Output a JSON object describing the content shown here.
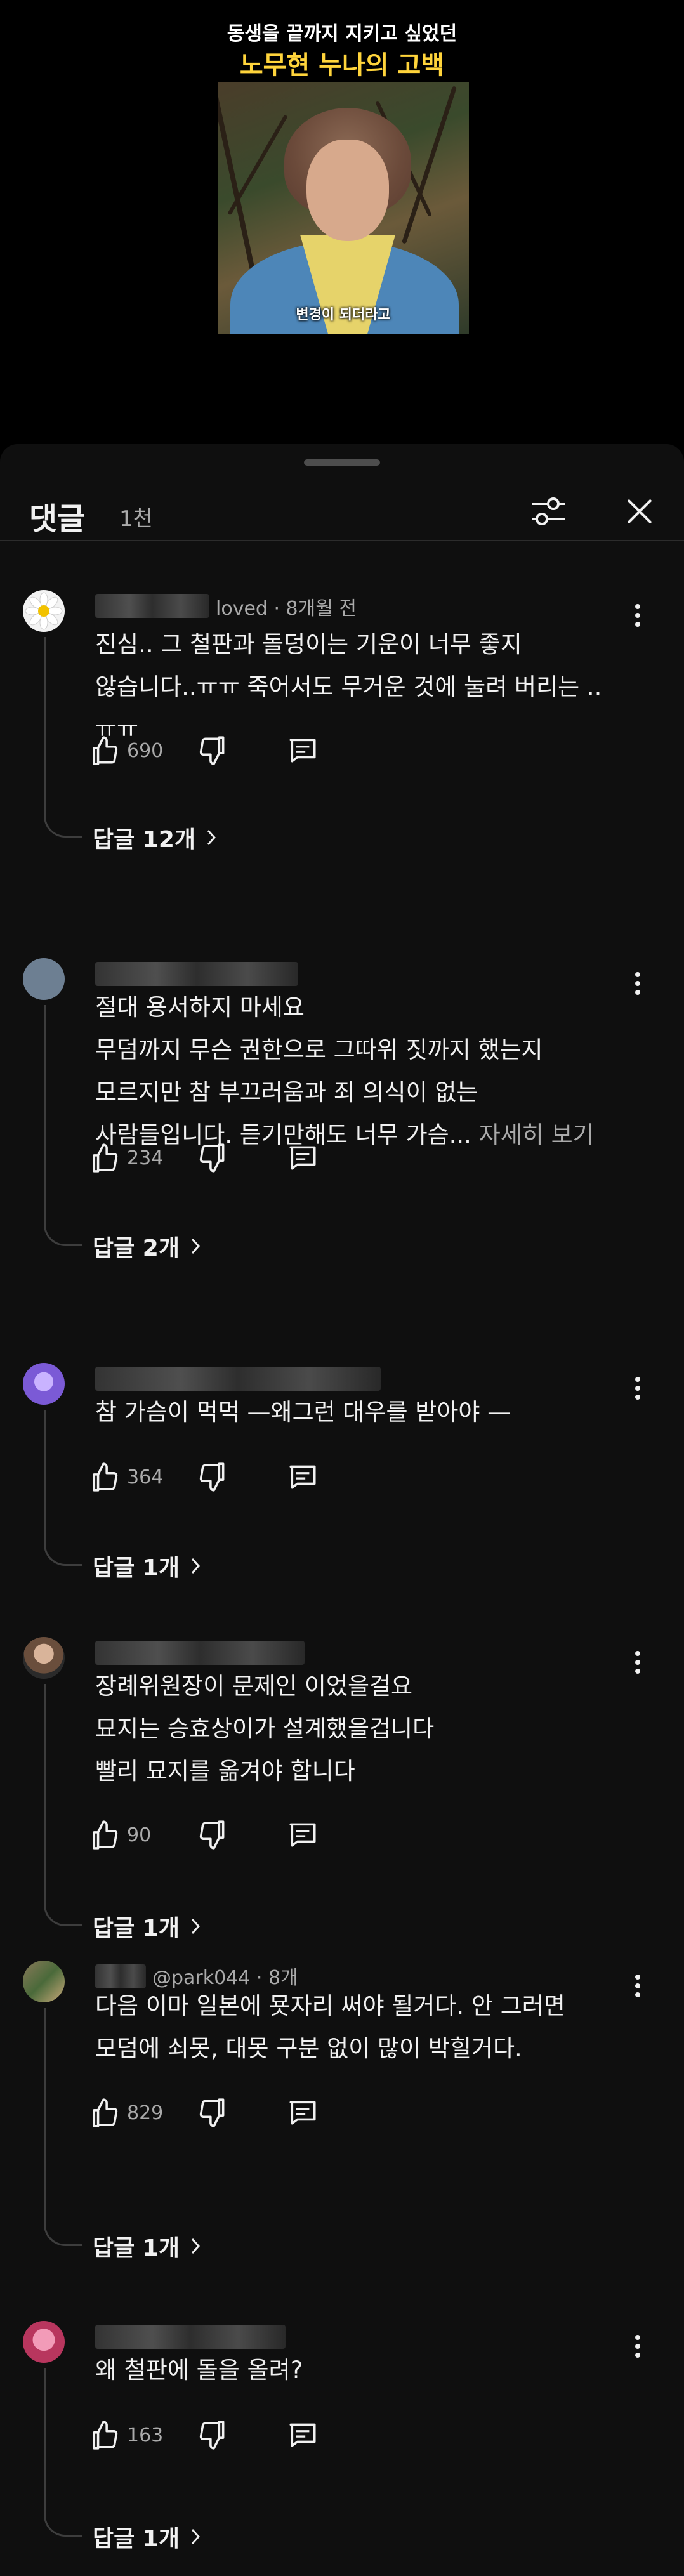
{
  "video": {
    "caption_line1": "동생을 끝까지 지키고 싶었던",
    "caption_line2": "노무현 누나의 고백",
    "subtitle": "변경이 되더라고"
  },
  "sheet": {
    "title": "댓글",
    "count": "1천"
  },
  "comments": [
    {
      "meta": "loved · 8개월 전",
      "lines": [
        "진심.. 그 철판과 돌덩이는 기운이 너무 좋지",
        "않습니다..ㅠㅠ 죽어서도 무거운 것에 눌려 버리는 ..",
        "ㅠㅠ"
      ],
      "read_more": "",
      "likes": "690",
      "replies": "답글 12개"
    },
    {
      "meta": "",
      "lines": [
        "절대 용서하지 마세요",
        "무덤까지 무슨 권한으로 그따위 짓까지 했는지",
        "모르지만 참 부끄러움과 죄 의식이 없는",
        "사람들입니다. 듣기만해도 너무 가슴... "
      ],
      "read_more": "자세히 보기",
      "likes": "234",
      "replies": "답글 2개"
    },
    {
      "meta": "",
      "lines": [
        "참 가슴이 먹먹 —왜그런 대우를 받아야 —"
      ],
      "read_more": "",
      "likes": "364",
      "replies": "답글 1개"
    },
    {
      "meta": "",
      "lines": [
        "장례위원장이 문제인 이었을걸요",
        "묘지는 승효상이가 설계했을겁니다",
        "빨리 묘지를 옮겨야 합니다"
      ],
      "read_more": "",
      "likes": "90",
      "replies": "답글 1개"
    },
    {
      "meta": "@park044 · 8개",
      "lines": [
        "다음 이마 일본에 묫자리 써야 될거다. 안 그러면",
        "모덤에 쇠못, 대못 구분 없이 많이 박힐거다."
      ],
      "read_more": "",
      "likes": "829",
      "replies": "답글 1개"
    },
    {
      "meta": "",
      "lines": [
        "왜 철판에 돌을 올려?"
      ],
      "read_more": "",
      "likes": "163",
      "replies": "답글 1개"
    }
  ],
  "colors": {
    "sheet_bg": "#0f0f0f",
    "text_primary": "#f1f1f1",
    "text_secondary": "#aaaaaa",
    "caption_yellow": "#ffd43b"
  }
}
